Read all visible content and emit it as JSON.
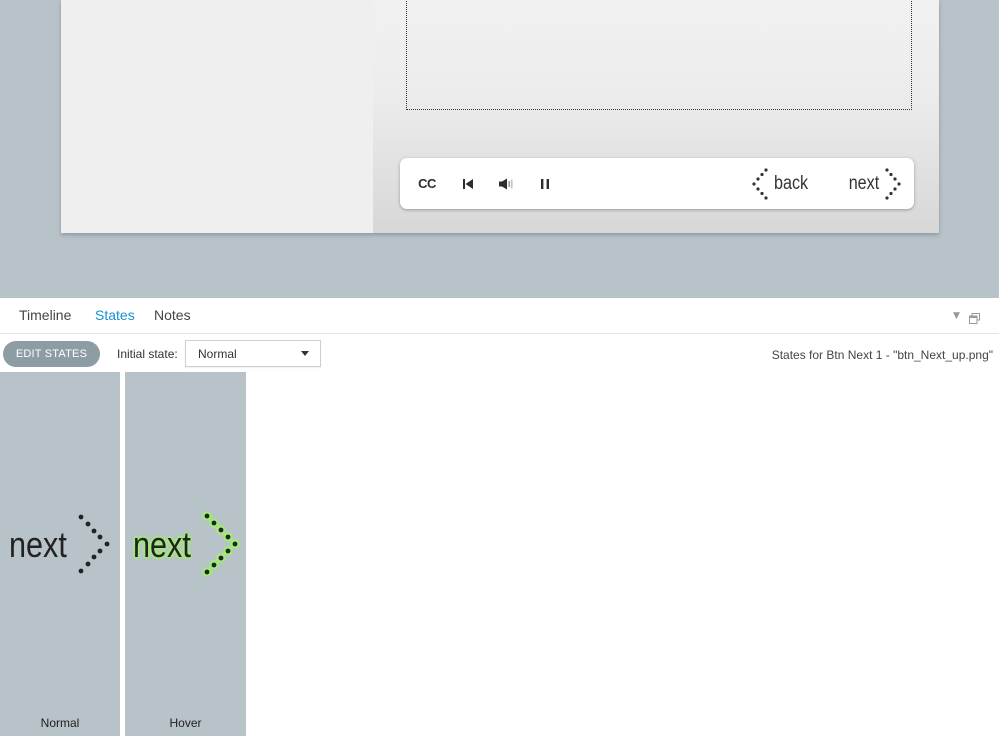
{
  "player": {
    "cc_label": "CC",
    "back_label": "back",
    "next_label": "next"
  },
  "tabs": [
    {
      "label": "Timeline"
    },
    {
      "label": "States"
    },
    {
      "label": "Notes"
    }
  ],
  "active_tab": "States",
  "toolbar": {
    "edit_states_label": "EDIT STATES",
    "initial_state_label": "Initial state:",
    "initial_state_value": "Normal",
    "states_for_text": "States for Btn Next 1 - \"btn_Next_up.png\""
  },
  "states": [
    {
      "name": "Normal",
      "art_text": "next",
      "text_color": "#222222"
    },
    {
      "name": "Hover",
      "art_text": "next",
      "text_color": "#222222",
      "glow_color": "#a3e87a"
    }
  ],
  "colors": {
    "stage_bg": "#b7c2c9",
    "accent": "#1a8fd0",
    "edit_states_bg": "#8e9ca4"
  },
  "icons": {
    "prev": "skip-back-icon",
    "volume": "volume-icon",
    "pause": "pause-icon",
    "back_chevron": "dotted-chevron-left-icon",
    "next_chevron": "dotted-chevron-right-icon",
    "panel_menu": "dropdown-arrow-icon",
    "panel_float": "float-window-icon"
  }
}
